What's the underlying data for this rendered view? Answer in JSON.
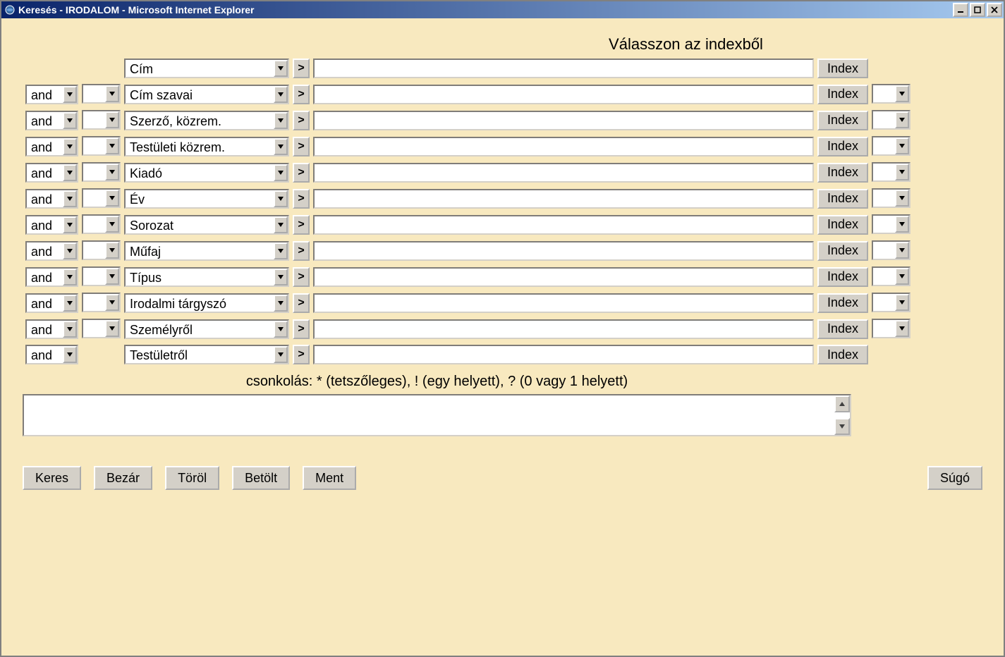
{
  "window": {
    "title": "Keresés - IRODALOM - Microsoft Internet Explorer"
  },
  "header": "Válasszon az indexből",
  "truncation_hint": "csonkolás: * (tetszőleges), ! (egy helyett), ? (0 vagy 1 helyett)",
  "labels": {
    "gt": ">",
    "index": "Index"
  },
  "rows": [
    {
      "op": "",
      "op_blank": false,
      "blank2": false,
      "field": "Cím",
      "tail": false
    },
    {
      "op": "and",
      "op_blank": true,
      "blank2": true,
      "field": "Cím szavai",
      "tail": true
    },
    {
      "op": "and",
      "op_blank": true,
      "blank2": true,
      "field": "Szerző, közrem.",
      "tail": true
    },
    {
      "op": "and",
      "op_blank": true,
      "blank2": true,
      "field": "Testületi közrem.",
      "tail": true
    },
    {
      "op": "and",
      "op_blank": true,
      "blank2": true,
      "field": "Kiadó",
      "tail": true
    },
    {
      "op": "and",
      "op_blank": true,
      "blank2": true,
      "field": "Év",
      "tail": true
    },
    {
      "op": "and",
      "op_blank": true,
      "blank2": true,
      "field": "Sorozat",
      "tail": true
    },
    {
      "op": "and",
      "op_blank": true,
      "blank2": true,
      "field": "Műfaj",
      "tail": true
    },
    {
      "op": "and",
      "op_blank": true,
      "blank2": true,
      "field": "Típus",
      "tail": true
    },
    {
      "op": "and",
      "op_blank": true,
      "blank2": true,
      "field": "Irodalmi tárgyszó",
      "tail": true
    },
    {
      "op": "and",
      "op_blank": true,
      "blank2": true,
      "field": "Személyről",
      "tail": true
    },
    {
      "op": "and",
      "op_blank": true,
      "blank2": false,
      "field": "Testületről",
      "tail": false
    }
  ],
  "actions": {
    "search": "Keres",
    "close": "Bezár",
    "clear": "Töröl",
    "load": "Betölt",
    "save": "Ment",
    "help": "Súgó"
  }
}
